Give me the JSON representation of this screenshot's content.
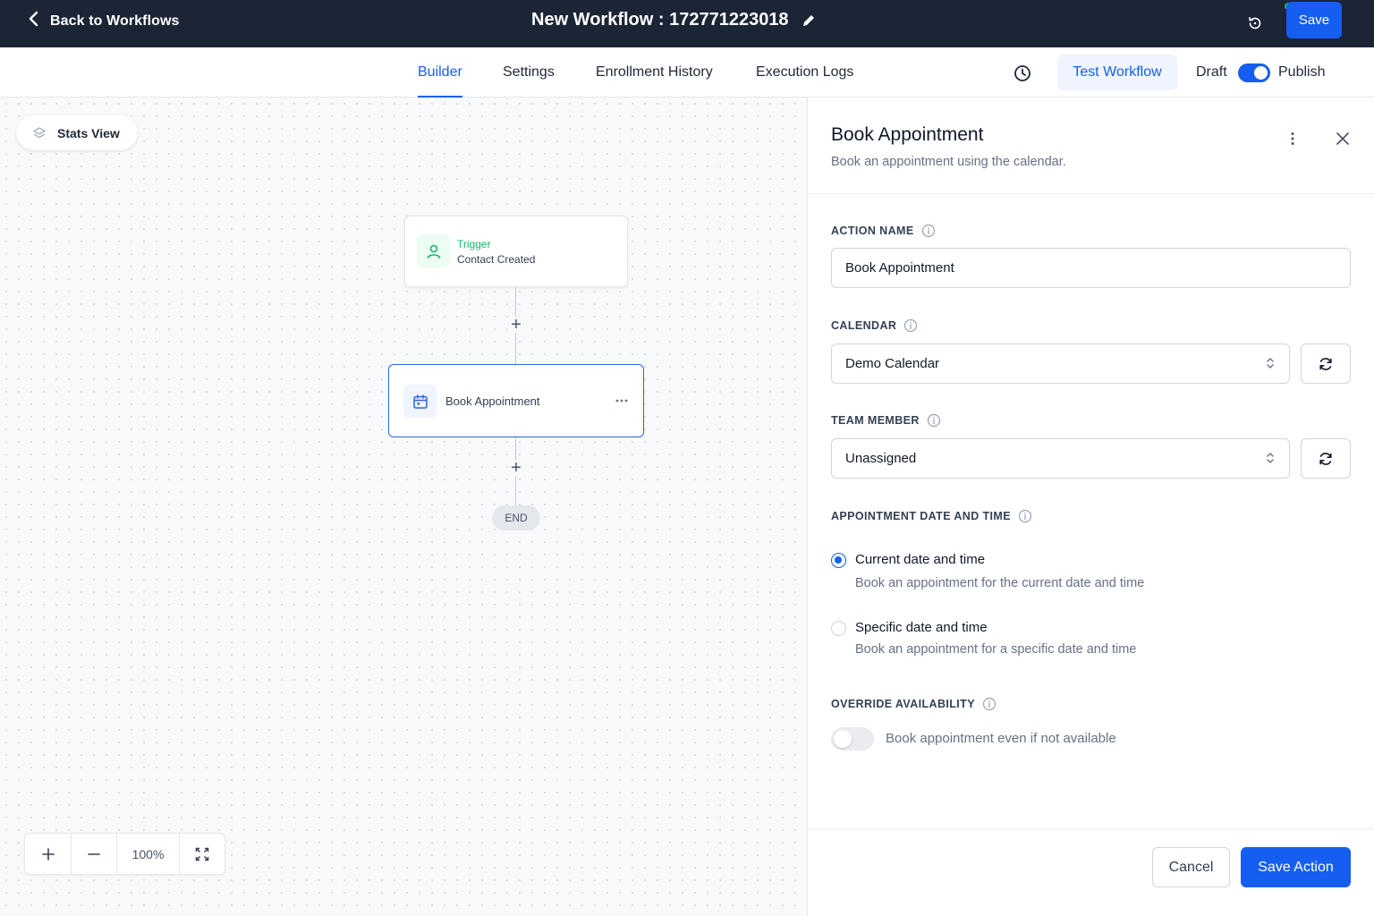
{
  "header": {
    "back_label": "Back to Workflows",
    "title": "New Workflow : 172771223018",
    "save_label": "Save"
  },
  "tabs": [
    {
      "label": "Builder",
      "active": true
    },
    {
      "label": "Settings",
      "active": false
    },
    {
      "label": "Enrollment History",
      "active": false
    },
    {
      "label": "Execution Logs",
      "active": false
    }
  ],
  "tabbar": {
    "test_label": "Test Workflow",
    "draft_label": "Draft",
    "publish_label": "Publish",
    "published": true
  },
  "canvas": {
    "stats_view_label": "Stats View",
    "trigger": {
      "type": "Trigger",
      "description": "Contact Created"
    },
    "action": {
      "label": "Book Appointment"
    },
    "end_label": "END",
    "zoom_level": "100%"
  },
  "panel": {
    "title": "Book Appointment",
    "subtitle": "Book an appointment using the calendar.",
    "action_name": {
      "label": "ACTION NAME",
      "value": "Book Appointment"
    },
    "calendar": {
      "label": "CALENDAR",
      "value": "Demo Calendar"
    },
    "team_member": {
      "label": "TEAM MEMBER",
      "value": "Unassigned"
    },
    "appointment": {
      "label": "APPOINTMENT DATE AND TIME",
      "options": [
        {
          "title": "Current date and time",
          "description": "Book an appointment for the current date and time",
          "selected": true
        },
        {
          "title": "Specific date and time",
          "description": "Book an appointment for a specific date and time",
          "selected": false
        }
      ]
    },
    "override": {
      "label": "OVERRIDE AVAILABILITY",
      "toggle_label": "Book appointment even if not available",
      "enabled": false
    },
    "cancel_label": "Cancel",
    "save_action_label": "Save Action"
  },
  "colors": {
    "header_bg": "#1c2536",
    "accent": "#155eef",
    "trigger_green": "#12b76a"
  }
}
